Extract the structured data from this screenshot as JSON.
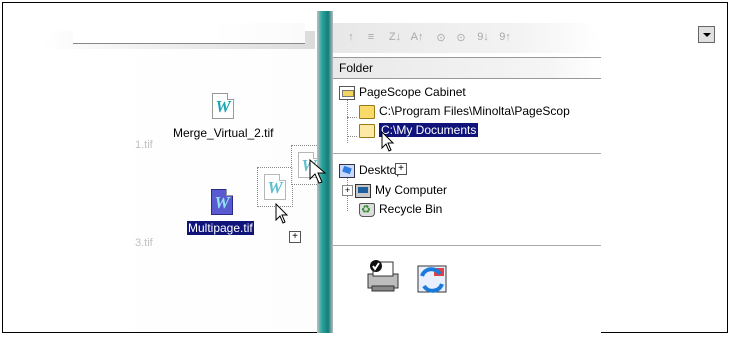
{
  "left_pane": {
    "files": [
      {
        "name": "Merge_Virtual_2.tif",
        "selected": false,
        "partial_prefix": "1.tif"
      },
      {
        "name": "Multipage.tif",
        "selected": true,
        "partial_prefix": "3.tif"
      }
    ]
  },
  "right_pane": {
    "header": "Folder",
    "tree_top": [
      {
        "label": "PageScope Cabinet",
        "icon": "cabinet-icon"
      },
      {
        "label": "C:\\Program Files\\Minolta\\PageScop",
        "icon": "folder-icon"
      },
      {
        "label": "C:\\My Documents",
        "icon": "folder-open-icon",
        "selected": true
      }
    ],
    "tree_bottom": [
      {
        "label": "Desktop",
        "icon": "desktop-icon"
      },
      {
        "label": "My Computer",
        "icon": "computer-icon",
        "expander": "+"
      },
      {
        "label": "Recycle Bin",
        "icon": "recycle-bin-icon"
      }
    ],
    "toolbar_icons": [
      "move-up-icon",
      "list-view-icon",
      "sort-ascending-icon",
      "sort-descending-icon",
      "zoom-icon",
      "rotate-icon",
      "sort-numeric-icon",
      "sort-numeric-desc-icon"
    ],
    "bottom_buttons": [
      "print-icon",
      "send-icon"
    ]
  },
  "colors": {
    "selection": "#10147a",
    "splitter": "#137d79",
    "w_icon": "#1aa6b7"
  }
}
